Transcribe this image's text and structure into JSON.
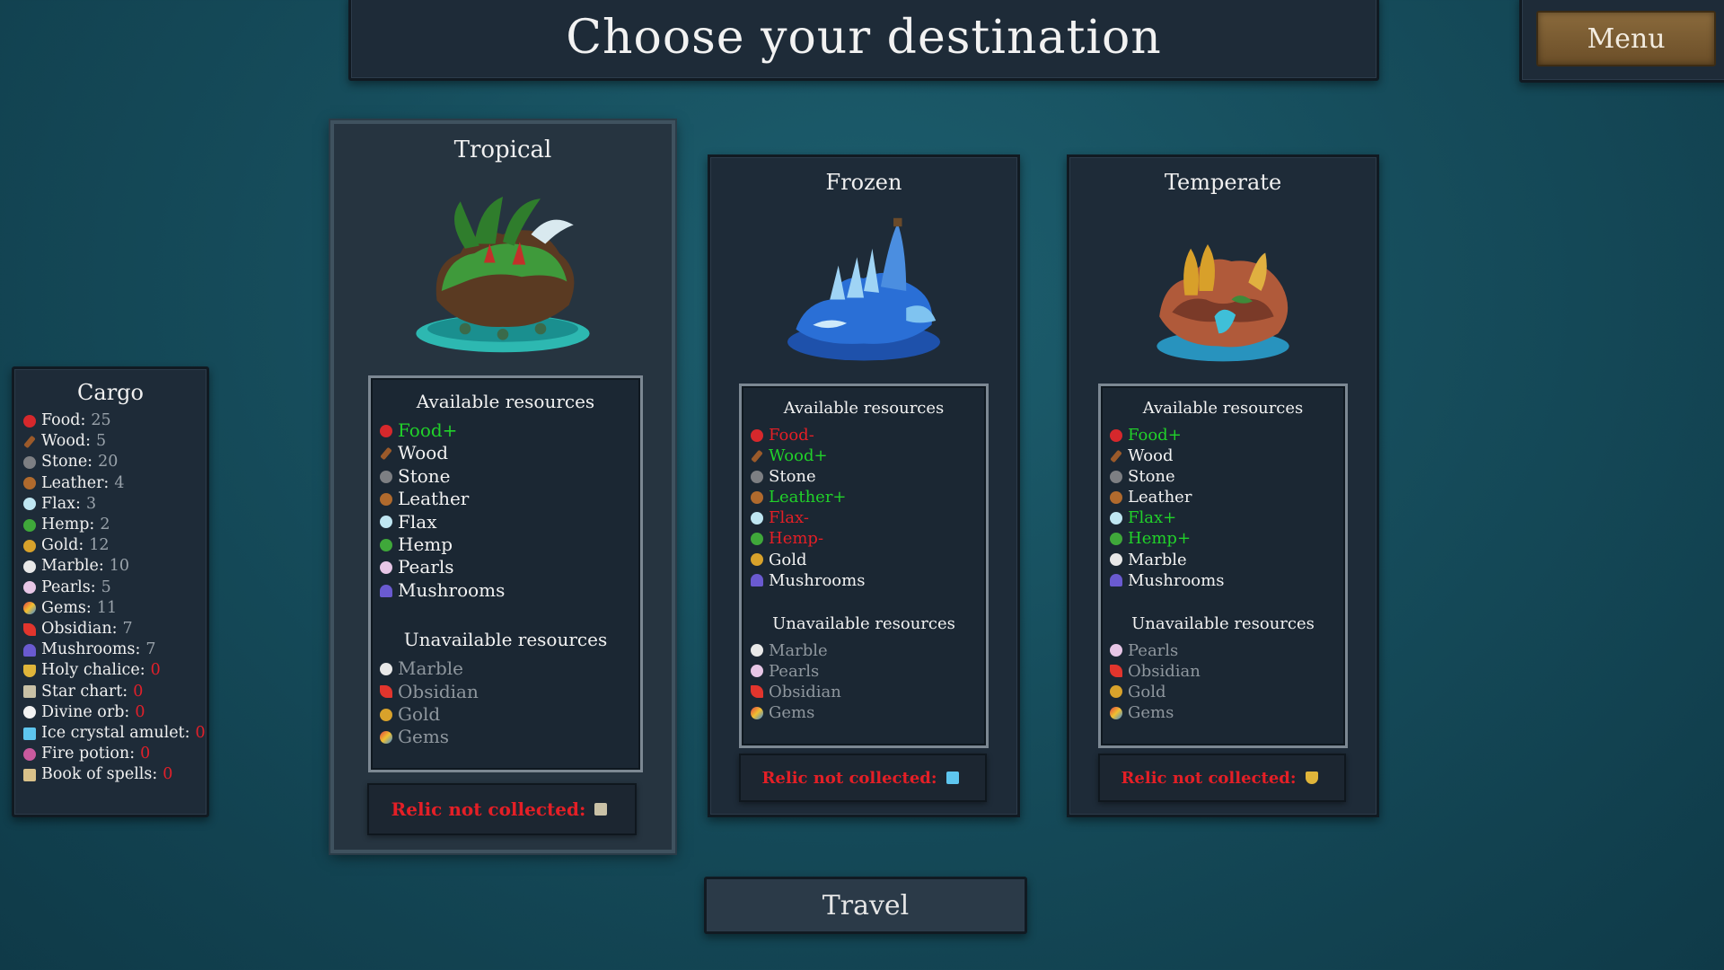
{
  "header": {
    "title": "Choose your destination",
    "menu_label": "Menu"
  },
  "cargo": {
    "title": "Cargo",
    "items": [
      {
        "icon": "food-icon",
        "label": "Food:",
        "value": "25",
        "zero": false
      },
      {
        "icon": "wood-icon",
        "label": "Wood:",
        "value": "5",
        "zero": false
      },
      {
        "icon": "stone-icon",
        "label": "Stone:",
        "value": "20",
        "zero": false
      },
      {
        "icon": "leather-icon",
        "label": "Leather:",
        "value": "4",
        "zero": false
      },
      {
        "icon": "flax-icon",
        "label": "Flax:",
        "value": "3",
        "zero": false
      },
      {
        "icon": "hemp-icon",
        "label": "Hemp:",
        "value": "2",
        "zero": false
      },
      {
        "icon": "gold-icon",
        "label": "Gold:",
        "value": "12",
        "zero": false
      },
      {
        "icon": "marble-icon",
        "label": "Marble:",
        "value": "10",
        "zero": false
      },
      {
        "icon": "pearls-icon",
        "label": "Pearls:",
        "value": "5",
        "zero": false
      },
      {
        "icon": "gems-icon",
        "label": "Gems:",
        "value": "11",
        "zero": false
      },
      {
        "icon": "obsidian-icon",
        "label": "Obsidian:",
        "value": "7",
        "zero": false
      },
      {
        "icon": "mushrooms-icon",
        "label": "Mushrooms:",
        "value": "7",
        "zero": false
      },
      {
        "icon": "chalice-icon",
        "label": "Holy chalice:",
        "value": "0",
        "zero": true
      },
      {
        "icon": "starchart-icon",
        "label": "Star chart:",
        "value": "0",
        "zero": true
      },
      {
        "icon": "orb-icon",
        "label": "Divine orb:",
        "value": "0",
        "zero": true
      },
      {
        "icon": "amulet-icon",
        "label": "Ice crystal amulet:",
        "value": "0",
        "zero": true
      },
      {
        "icon": "potion-icon",
        "label": "Fire potion:",
        "value": "0",
        "zero": true
      },
      {
        "icon": "book-icon",
        "label": "Book of spells:",
        "value": "0",
        "zero": true
      }
    ]
  },
  "destinations": [
    {
      "name": "Tropical",
      "selected": true,
      "available_title": "Available resources",
      "available": [
        {
          "icon": "food-icon",
          "label": "Food+",
          "status": "green"
        },
        {
          "icon": "wood-icon",
          "label": "Wood",
          "status": "white"
        },
        {
          "icon": "stone-icon",
          "label": "Stone",
          "status": "white"
        },
        {
          "icon": "leather-icon",
          "label": "Leather",
          "status": "white"
        },
        {
          "icon": "flax-icon",
          "label": "Flax",
          "status": "white"
        },
        {
          "icon": "hemp-icon",
          "label": "Hemp",
          "status": "white"
        },
        {
          "icon": "pearls-icon",
          "label": "Pearls",
          "status": "white"
        },
        {
          "icon": "mushrooms-icon",
          "label": "Mushrooms",
          "status": "white"
        }
      ],
      "unavailable_title": "Unavailable resources",
      "unavailable": [
        {
          "icon": "marble-icon",
          "label": "Marble"
        },
        {
          "icon": "obsidian-icon",
          "label": "Obsidian"
        },
        {
          "icon": "gold-icon",
          "label": "Gold"
        },
        {
          "icon": "gems-icon",
          "label": "Gems"
        }
      ],
      "relic_text": "Relic not collected:",
      "relic_icon": "starchart-icon"
    },
    {
      "name": "Frozen",
      "selected": false,
      "available_title": "Available resources",
      "available": [
        {
          "icon": "food-icon",
          "label": "Food-",
          "status": "red"
        },
        {
          "icon": "wood-icon",
          "label": "Wood+",
          "status": "green"
        },
        {
          "icon": "stone-icon",
          "label": "Stone",
          "status": "white"
        },
        {
          "icon": "leather-icon",
          "label": "Leather+",
          "status": "green"
        },
        {
          "icon": "flax-icon",
          "label": "Flax-",
          "status": "red"
        },
        {
          "icon": "hemp-icon",
          "label": "Hemp-",
          "status": "red"
        },
        {
          "icon": "gold-icon",
          "label": "Gold",
          "status": "white"
        },
        {
          "icon": "mushrooms-icon",
          "label": "Mushrooms",
          "status": "white"
        }
      ],
      "unavailable_title": "Unavailable resources",
      "unavailable": [
        {
          "icon": "marble-icon",
          "label": "Marble"
        },
        {
          "icon": "pearls-icon",
          "label": "Pearls"
        },
        {
          "icon": "obsidian-icon",
          "label": "Obsidian"
        },
        {
          "icon": "gems-icon",
          "label": "Gems"
        }
      ],
      "relic_text": "Relic not collected:",
      "relic_icon": "amulet-icon"
    },
    {
      "name": "Temperate",
      "selected": false,
      "available_title": "Available resources",
      "available": [
        {
          "icon": "food-icon",
          "label": "Food+",
          "status": "green"
        },
        {
          "icon": "wood-icon",
          "label": "Wood",
          "status": "white"
        },
        {
          "icon": "stone-icon",
          "label": "Stone",
          "status": "white"
        },
        {
          "icon": "leather-icon",
          "label": "Leather",
          "status": "white"
        },
        {
          "icon": "flax-icon",
          "label": "Flax+",
          "status": "green"
        },
        {
          "icon": "hemp-icon",
          "label": "Hemp+",
          "status": "green"
        },
        {
          "icon": "marble-icon",
          "label": "Marble",
          "status": "white"
        },
        {
          "icon": "mushrooms-icon",
          "label": "Mushrooms",
          "status": "white"
        }
      ],
      "unavailable_title": "Unavailable resources",
      "unavailable": [
        {
          "icon": "pearls-icon",
          "label": "Pearls"
        },
        {
          "icon": "obsidian-icon",
          "label": "Obsidian"
        },
        {
          "icon": "gold-icon",
          "label": "Gold"
        },
        {
          "icon": "gems-icon",
          "label": "Gems"
        }
      ],
      "relic_text": "Relic not collected:",
      "relic_icon": "chalice-icon"
    }
  ],
  "travel_label": "Travel"
}
